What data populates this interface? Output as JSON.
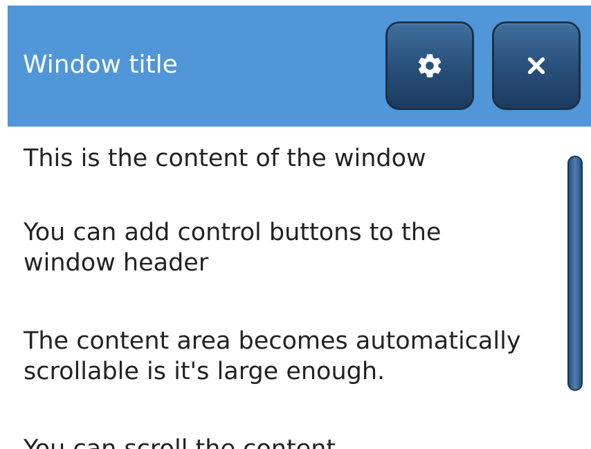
{
  "window": {
    "title": "Window title",
    "buttons": [
      {
        "label": "Settings",
        "icon": "gear-icon"
      },
      {
        "label": "Close",
        "icon": "close-icon"
      }
    ]
  },
  "content": {
    "paragraphs": [
      "This is the content of the window",
      "You can add control buttons to the window header",
      "The content area becomes automatically scrollable is it's large enough.",
      "You can scroll the content"
    ]
  },
  "colors": {
    "header": "#5096d8",
    "button": "#29507b",
    "scrollbar": "#3a6a9c",
    "text": "#222222"
  }
}
